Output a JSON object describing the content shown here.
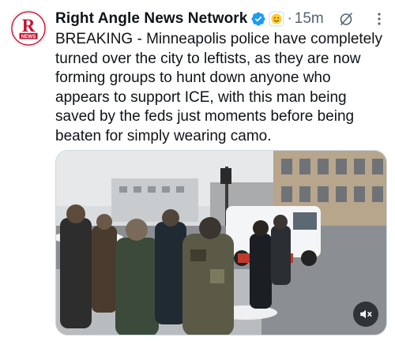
{
  "tweet": {
    "author": {
      "display_name": "Right Angle News Network",
      "avatar_text": "NEWS",
      "verified": true,
      "affiliate_badge": "emoji-badge-icon"
    },
    "separator": "·",
    "timestamp": "15m",
    "text": "BREAKING - Minneapolis police have completely turned over the city to leftists, as they are now forming groups to hunt down anyone who appears to support ICE, with this man being saved by the feds just moments before being beaten for simply wearing camo.",
    "media": {
      "type": "video",
      "muted_icon": "speaker-muted-icon"
    },
    "actions": {
      "grok_icon": "grok-icon",
      "more_icon": "more-options-icon"
    }
  },
  "colors": {
    "text_primary": "#0f1419",
    "text_secondary": "#536471",
    "verified_blue": "#1d9bf0",
    "logo_red": "#c8102e"
  }
}
